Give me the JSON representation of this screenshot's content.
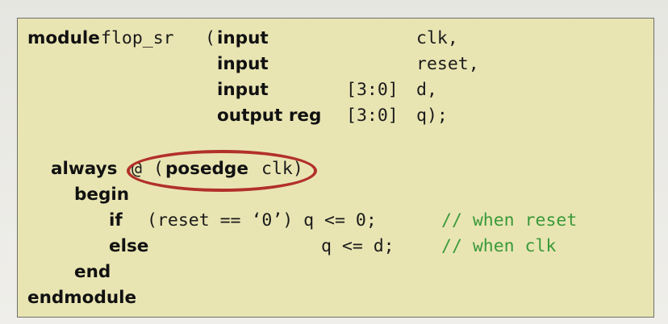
{
  "code": {
    "line1": {
      "kw_module": "module",
      "name": "flop_sr",
      "paren": "(",
      "kw_input": "input",
      "signal": "clk,"
    },
    "line2": {
      "kw_input": "input",
      "signal": "reset,"
    },
    "line3": {
      "kw_input": "input",
      "range": "[3:0]",
      "signal": "d,"
    },
    "line4": {
      "kw_output_reg": "output reg",
      "range": "[3:0]",
      "signal": "q);"
    },
    "line5": {
      "kw_always": "always",
      "at": "@",
      "open": "(",
      "kw_posedge": "posedge",
      "signal": "clk)"
    },
    "line6": {
      "kw_begin": "begin"
    },
    "line7": {
      "kw_if": "if",
      "condition": "(reset == ‘0’) q <= 0;",
      "comment": "// when reset"
    },
    "line8": {
      "kw_else": "else",
      "statement": "q <= d;",
      "comment": "// when clk"
    },
    "line9": {
      "kw_end": "end"
    },
    "line10": {
      "kw_endmodule": "endmodule"
    }
  },
  "colors": {
    "panel_background": "#e9e5b3",
    "comment": "#3a9a3a",
    "highlight_ellipse": "#b2302a"
  }
}
